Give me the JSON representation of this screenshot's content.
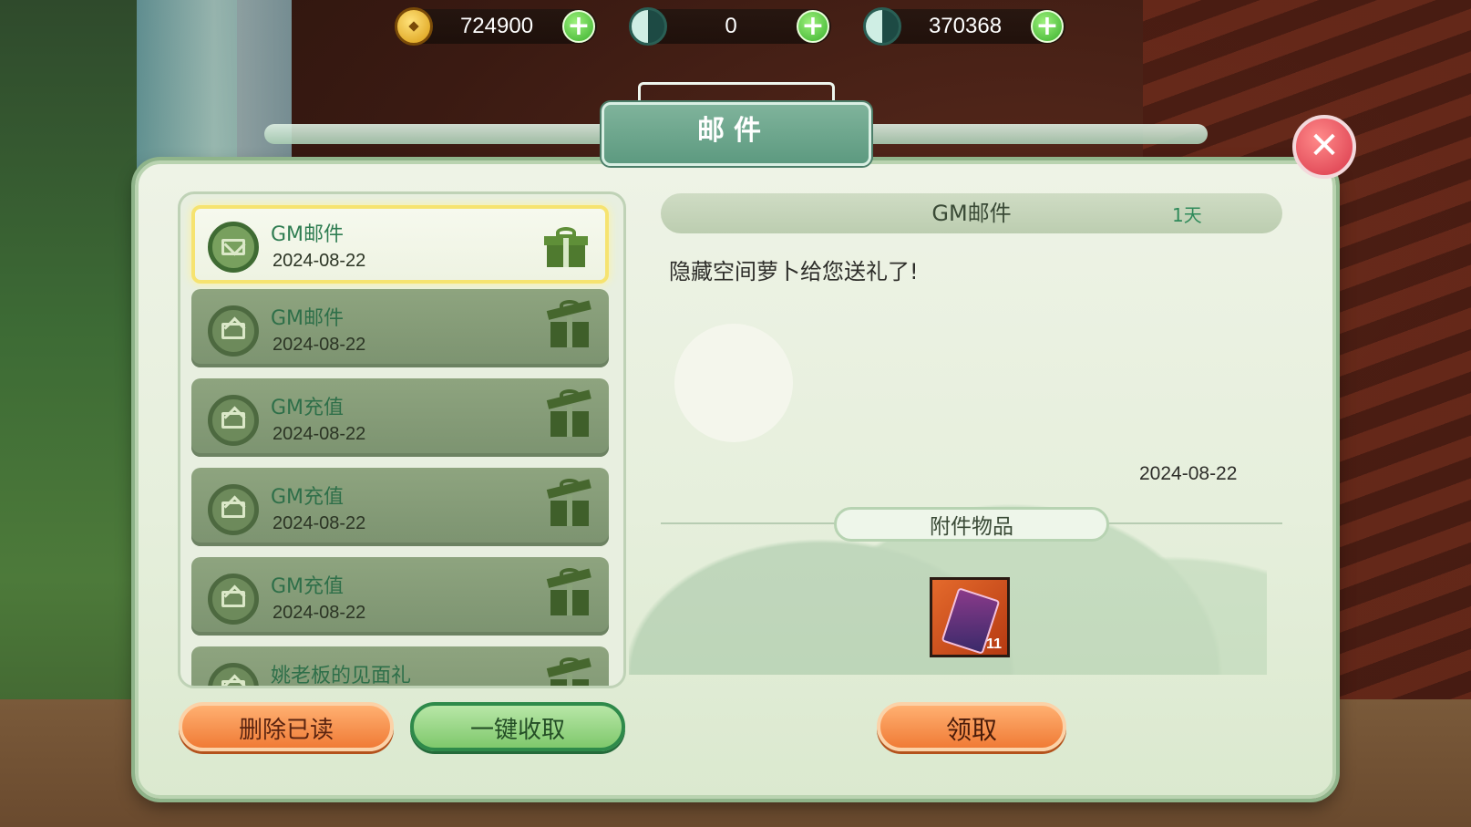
{
  "currency": [
    {
      "icon": "gold-coin-icon",
      "value": "724900"
    },
    {
      "icon": "yin-yang-key-icon",
      "value": "0"
    },
    {
      "icon": "yin-yang-icon",
      "value": "370368"
    }
  ],
  "window": {
    "title": "邮件"
  },
  "mail_list": [
    {
      "name": "GM邮件",
      "date": "2024-08-22",
      "selected": true,
      "gift": "unopened"
    },
    {
      "name": "GM邮件",
      "date": "2024-08-22",
      "selected": false,
      "gift": "opened"
    },
    {
      "name": "GM充值",
      "date": "2024-08-22",
      "selected": false,
      "gift": "opened"
    },
    {
      "name": "GM充值",
      "date": "2024-08-22",
      "selected": false,
      "gift": "opened"
    },
    {
      "name": "GM充值",
      "date": "2024-08-22",
      "selected": false,
      "gift": "opened"
    },
    {
      "name": "姚老板的见面礼",
      "date": "",
      "selected": false,
      "gift": "opened"
    }
  ],
  "buttons": {
    "delete_read": "删除已读",
    "claim_all": "一键收取",
    "claim": "领取"
  },
  "detail": {
    "title": "GM邮件",
    "expires": "1天",
    "body": "隐藏空间萝卜给您送礼了!",
    "date": "2024-08-22",
    "attachments_label": "附件物品",
    "attachments": [
      {
        "icon": "purple-card-item-icon",
        "count": "11"
      }
    ]
  },
  "colors": {
    "panel": "#e6efdc",
    "accent_orange": "#f07b36",
    "accent_green": "#7fc86c",
    "text_green": "#2f7d52"
  }
}
